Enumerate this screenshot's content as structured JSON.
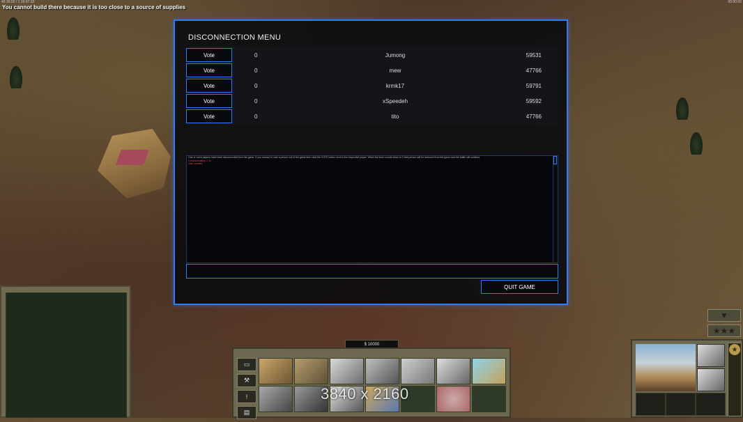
{
  "hud": {
    "top_left_info": "40 30.02 / 1 16:07:33",
    "top_right_info": "00:00:00",
    "message": "You cannot build there because it is too close to a source of supplies"
  },
  "dialog": {
    "title": "DISCONNECTION MENU",
    "players": [
      {
        "vote_label": "Vote",
        "votes": "0",
        "name": "Jumong",
        "ping": "59531"
      },
      {
        "vote_label": "Vote",
        "votes": "0",
        "name": "mew",
        "ping": "47766"
      },
      {
        "vote_label": "Vote",
        "votes": "0",
        "name": "krmk17",
        "ping": "59791"
      },
      {
        "vote_label": "Vote",
        "votes": "0",
        "name": "xSpeedeh",
        "ping": "59592"
      },
      {
        "vote_label": "Vote",
        "votes": "0",
        "name": "tito",
        "ping": "47766"
      }
    ],
    "log_lines": [
      "One or more players have been disconnected from the game. If you choose to vote a person out of the game then click the VOTE button next to the respective player. When the timer counts down to 0 that person will be removed from the game and the battle will continue.",
      "Communicating: 2.1s",
      "Vote counted"
    ],
    "chat_input_value": "",
    "quit_label": "QUIT GAME"
  },
  "command_bar": {
    "money": "$ 10000",
    "tabs": [
      "▭",
      "⚒",
      "!",
      "▤"
    ],
    "watermark": "3840 x 2160"
  },
  "right_hud": {
    "collapse_icon": "▼",
    "rank_stars": "★★★",
    "rank_icon": "★"
  },
  "colors": {
    "dialog_border": "#2f7bff",
    "dialog_bg": "#08090c"
  }
}
